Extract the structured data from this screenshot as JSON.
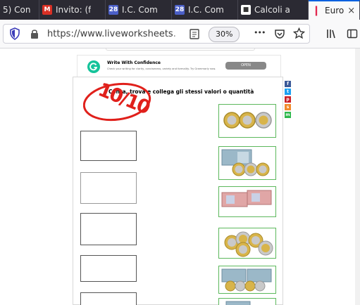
{
  "tabs": [
    {
      "label": "5) Con",
      "icon": "chat-icon"
    },
    {
      "label": "Invito: (f",
      "icon": "gmail-icon"
    },
    {
      "label": "I.C. Com",
      "icon": "calendar-icon",
      "icon_text": "28"
    },
    {
      "label": "I.C. Com",
      "icon": "calendar-icon",
      "icon_text": "28"
    },
    {
      "label": "Calcoli a",
      "icon": "classroom-icon"
    },
    {
      "label": "Euro",
      "icon": "liveworksheets-icon",
      "close": "×"
    }
  ],
  "toolbar": {
    "url_main": "https://www.liveworksheets",
    "url_rest": ".",
    "zoom": "30%",
    "more_label": "•••"
  },
  "ad": {
    "title": "Write With Confidence",
    "text": "Check your writing for clarity, conciseness, variety and formality. Try Grammarly now.",
    "button": "OPEN"
  },
  "worksheet": {
    "title": "Conta, trova e collega gli stessi valori o quantità",
    "score": "10/10"
  },
  "share": [
    "f",
    "t",
    "p",
    "s",
    "m"
  ],
  "colors": {
    "accent": "#0060df",
    "score_red": "#e0201b",
    "tile_border": "#5cb85c"
  }
}
